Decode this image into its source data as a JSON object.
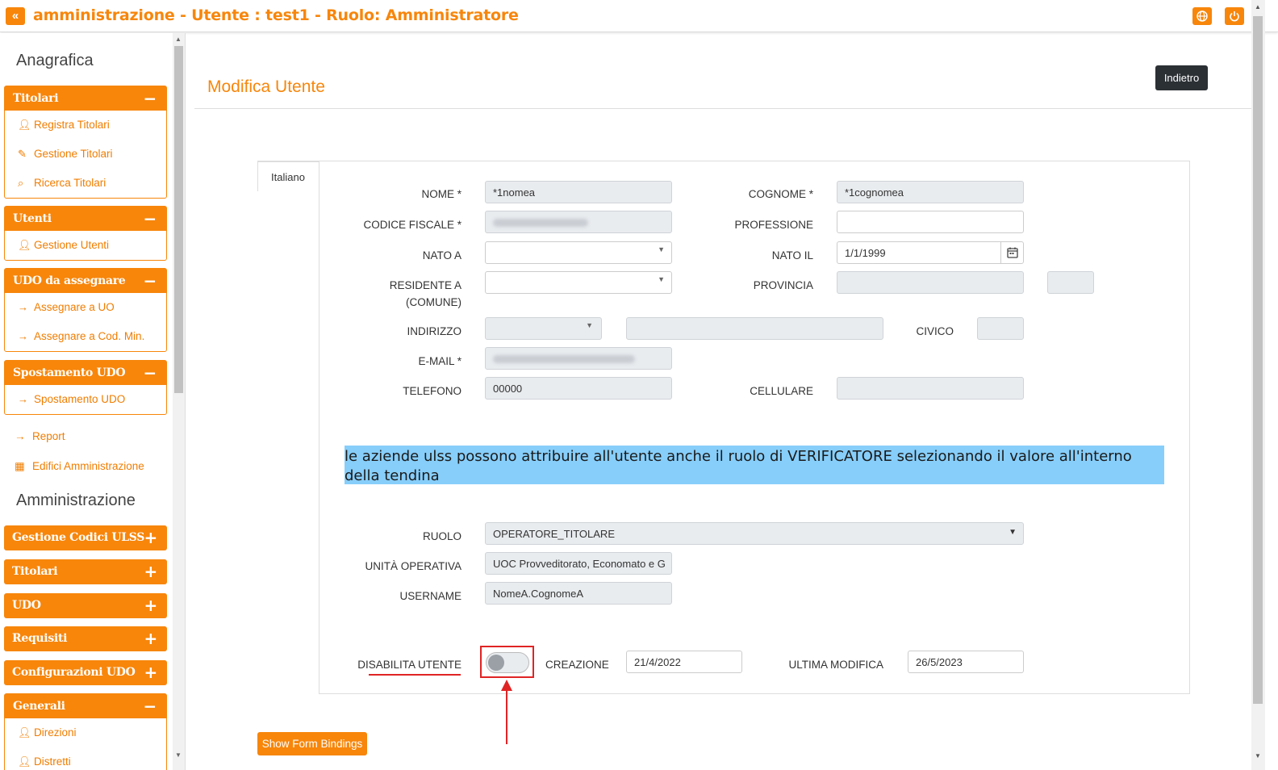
{
  "header": {
    "collapse_icon": "double-chevron-left-icon",
    "title": "amministrazione - Utente : test1 - Ruolo: Amministratore",
    "language_icon": "globe-icon",
    "power_icon": "power-icon"
  },
  "sidebar": {
    "section_anagrafica": "Anagrafica",
    "group_titolari": {
      "label": "Titolari",
      "sign": "−",
      "items": [
        "Registra Titolari",
        "Gestione Titolari",
        "Ricerca Titolari"
      ]
    },
    "group_utenti": {
      "label": "Utenti",
      "sign": "−",
      "items": [
        "Gestione Utenti"
      ]
    },
    "group_udo_assegnare": {
      "label": "UDO da assegnare",
      "sign": "−",
      "items": [
        "Assegnare a UO",
        "Assegnare a Cod. Min."
      ]
    },
    "group_spostamento": {
      "label": "Spostamento UDO",
      "sign": "−",
      "items": [
        "Spostamento UDO"
      ]
    },
    "report": "Report",
    "edifici": "Edifici Amministrazione",
    "section_amministrazione": "Amministrazione",
    "collapsed_groups": [
      "Gestione Codici ULSS",
      "Titolari",
      "UDO",
      "Requisiti",
      "Configurazioni UDO"
    ],
    "plus_sign": "+",
    "group_generali": {
      "label": "Generali",
      "sign": "−",
      "items": [
        "Direzioni",
        "Distretti"
      ]
    }
  },
  "main": {
    "page_title": "Modifica Utente",
    "back_button": "Indietro",
    "tab": "Italiano",
    "labels": {
      "nome": "NOME *",
      "cognome": "COGNOME *",
      "codice_fiscale": "CODICE FISCALE *",
      "professione": "PROFESSIONE",
      "nato_a": "NATO A",
      "nato_il": "NATO IL",
      "residente_1": "RESIDENTE A",
      "residente_2": "(COMUNE)",
      "provincia": "PROVINCIA",
      "indirizzo": "INDIRIZZO",
      "civico": "CIVICO",
      "email": "E-MAIL *",
      "telefono": "TELEFONO",
      "cellulare": "CELLULARE",
      "ruolo": "RUOLO",
      "unita_operativa": "UNITÀ OPERATIVA",
      "username": "USERNAME",
      "disabilita": "DISABILITA UTENTE",
      "creazione": "CREAZIONE",
      "ultima_modifica": "ULTIMA MODIFICA"
    },
    "values": {
      "nome": "*1nomea",
      "cognome": "*1cognomea",
      "professione": "",
      "nato_a": "",
      "nato_il": "1/1/1999",
      "residente": "",
      "provincia": "",
      "provincia_sigla": "",
      "indirizzo_tipo": "",
      "indirizzo": "",
      "civico": "",
      "telefono": "00000",
      "cellulare": "",
      "ruolo": "OPERATORE_TITOLARE",
      "unita_operativa": "UOC Provveditorato, Economato e G",
      "username": "NomeA.CognomeA",
      "creazione": "21/4/2022",
      "ultima_modifica": "26/5/2023"
    },
    "disabilita_toggle_on": false,
    "calendar_icon": "calendar-icon",
    "info_banner": "le aziende ulss possono attribuire all'utente anche il ruolo di VERIFICATORE selezionando il valore all'interno della tendina",
    "show_bindings_button": "Show Form Bindings"
  }
}
